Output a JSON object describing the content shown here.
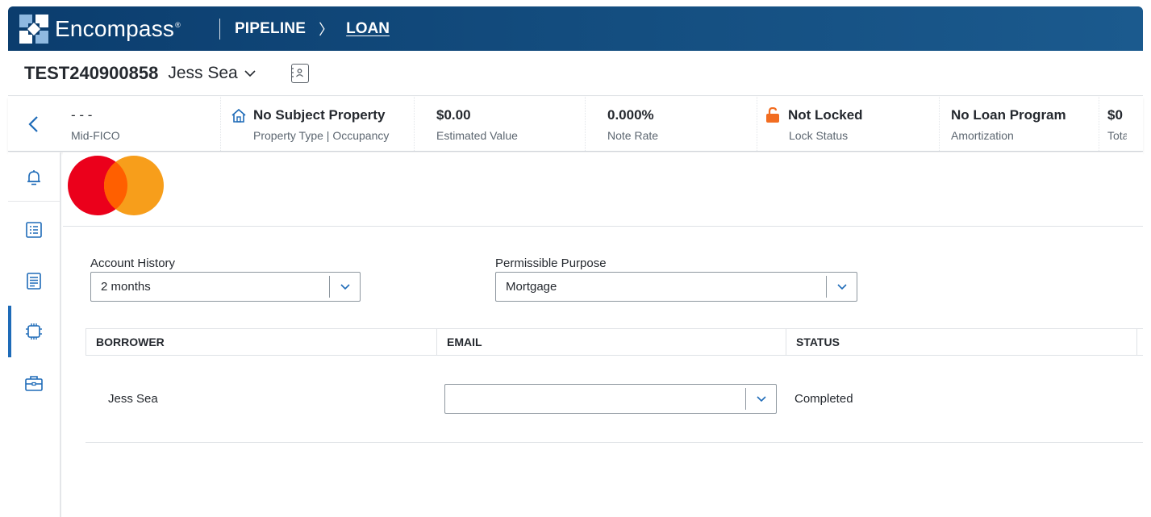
{
  "app": {
    "name": "Encompass",
    "trademark": "®",
    "breadcrumb": [
      "PIPELINE",
      "LOAN"
    ],
    "breadcrumb_separator": "〉"
  },
  "loan": {
    "number": "TEST240900858",
    "borrower": "Jess Sea"
  },
  "summary": [
    {
      "value": "- - -",
      "label": "Mid-FICO",
      "icon": null
    },
    {
      "value": "No Subject Property",
      "label": "Property Type | Occupancy",
      "icon": "home-icon"
    },
    {
      "value": "$0.00",
      "label": "Estimated Value",
      "icon": null
    },
    {
      "value": "0.000%",
      "label": "Note Rate",
      "icon": null
    },
    {
      "value": "Not Locked",
      "label": "Lock Status",
      "icon": "unlocked-icon"
    },
    {
      "value": "No Loan Program",
      "label": "Amortization",
      "icon": null
    },
    {
      "value": "$0",
      "label": "Tota",
      "icon": null
    }
  ],
  "rail": [
    {
      "icon": "bell-icon",
      "active": false
    },
    {
      "icon": "list-icon",
      "active": false
    },
    {
      "icon": "document-icon",
      "active": false
    },
    {
      "icon": "chip-icon",
      "active": true
    },
    {
      "icon": "briefcase-icon",
      "active": false
    }
  ],
  "form": {
    "account_history_label": "Account History",
    "account_history_value": "2 months",
    "permissible_purpose_label": "Permissible Purpose",
    "permissible_purpose_value": "Mortgage"
  },
  "table": {
    "columns": [
      "BORROWER",
      "EMAIL",
      "STATUS"
    ],
    "rows": [
      {
        "borrower": "Jess Sea",
        "email": "",
        "status": "Completed"
      }
    ]
  },
  "colors": {
    "header_bg": "#0b3d6e",
    "accent_blue": "#1e6bb8",
    "lock_orange": "#f26d21",
    "mastercard_red": "#eb001b",
    "mastercard_orange": "#f79e1b",
    "mastercard_overlap": "#ff5f00"
  }
}
